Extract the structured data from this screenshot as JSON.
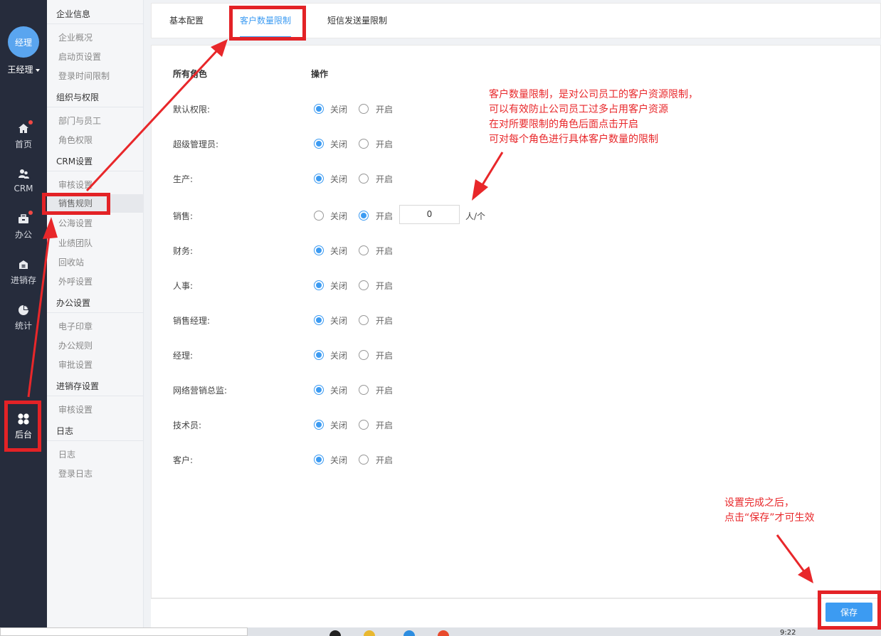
{
  "user": {
    "avatar_text": "经理",
    "name": "王经理"
  },
  "nav": [
    {
      "label": "首页",
      "icon": "home-icon",
      "badge": true
    },
    {
      "label": "CRM",
      "icon": "users-icon",
      "badge": false
    },
    {
      "label": "办公",
      "icon": "briefcase-icon",
      "badge": true
    },
    {
      "label": "进销存",
      "icon": "warehouse-icon",
      "badge": false
    },
    {
      "label": "统计",
      "icon": "pie-chart-icon",
      "badge": false
    },
    {
      "label": "后台",
      "icon": "grid-icon",
      "badge": false,
      "active": true
    }
  ],
  "menu": {
    "g1": "企业信息",
    "g1_items": [
      "企业概况",
      "启动页设置",
      "登录时间限制"
    ],
    "g2": "组织与权限",
    "g2_items": [
      "部门与员工",
      "角色权限"
    ],
    "g3": "CRM设置",
    "g3_items": [
      "审核设置",
      "销售规则",
      "公海设置",
      "业绩团队",
      "回收站",
      "外呼设置"
    ],
    "g4": "办公设置",
    "g4_items": [
      "电子印章",
      "办公规则",
      "审批设置"
    ],
    "g5": "进销存设置",
    "g5_items": [
      "审核设置"
    ],
    "g6": "日志",
    "g6_items": [
      "日志",
      "登录日志"
    ]
  },
  "tabs": [
    "基本配置",
    "客户数量限制",
    "短信发送量限制"
  ],
  "table": {
    "col_role": "所有角色",
    "col_action": "操作",
    "off_label": "关闭",
    "on_label": "开启",
    "unit": "人/个",
    "rows": [
      {
        "role": "默认权限:",
        "enabled": false
      },
      {
        "role": "超级管理员:",
        "enabled": false
      },
      {
        "role": "生产:",
        "enabled": false
      },
      {
        "role": "销售:",
        "enabled": true,
        "quantity": "0"
      },
      {
        "role": "财务:",
        "enabled": false
      },
      {
        "role": "人事:",
        "enabled": false
      },
      {
        "role": "销售经理:",
        "enabled": false
      },
      {
        "role": "经理:",
        "enabled": false
      },
      {
        "role": "网络营销总监:",
        "enabled": false
      },
      {
        "role": "技术员:",
        "enabled": false
      },
      {
        "role": "客户:",
        "enabled": false
      }
    ]
  },
  "save_label": "保存",
  "annotations": {
    "note1": [
      "客户数量限制，是对公司员工的客户资源限制，",
      "可以有效防止公司员工过多占用客户资源",
      "在对所要限制的角色后面点击开启",
      "可对每个角色进行具体客户数量的限制"
    ],
    "note2": [
      "设置完成之后，",
      "点击“保存”才可生效"
    ]
  },
  "taskbar": {
    "clock": "9:22"
  },
  "colors": {
    "accent": "#3c9bf2",
    "annotation": "#e32226",
    "nav_bg": "#262c3c"
  }
}
